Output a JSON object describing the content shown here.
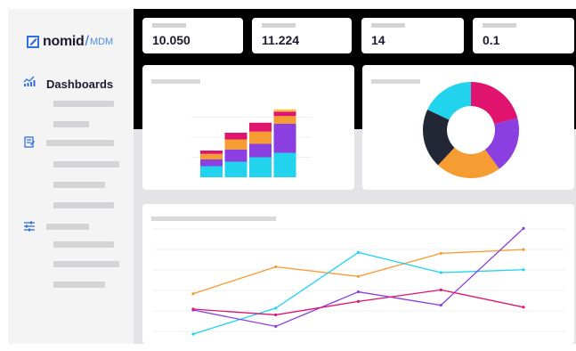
{
  "brand": {
    "name": "nomid",
    "separator": "/",
    "product": "MDM",
    "accent": "#2e6fdc"
  },
  "sidebar": {
    "items": [
      {
        "label": "Dashboards",
        "icon": "dashboard-chart-icon",
        "icon_color": "#2e6fdc"
      },
      {
        "label": "",
        "icon": "clipboard-icon",
        "icon_color": "#2e6fdc"
      },
      {
        "label": "",
        "icon": "sliders-icon",
        "icon_color": "#2e6fdc"
      }
    ]
  },
  "kpis": [
    {
      "value": "10.050"
    },
    {
      "value": "11.224"
    },
    {
      "value": "14"
    },
    {
      "value": "0.1"
    }
  ],
  "colors": {
    "cyan": "#22d3ee",
    "purple": "#8b3fe0",
    "orange": "#f59c32",
    "magenta": "#e0136e",
    "yellow": "#f5c242",
    "navy": "#232735"
  },
  "chart_data": [
    {
      "type": "bar",
      "stacked": true,
      "categories": [
        "",
        "",
        "",
        ""
      ],
      "series": [
        {
          "color": "#22d3ee",
          "values": [
            10,
            14,
            18,
            22
          ]
        },
        {
          "color": "#8b3fe0",
          "values": [
            6,
            11,
            12,
            26
          ]
        },
        {
          "color": "#f59c32",
          "values": [
            5,
            9,
            11,
            7
          ]
        },
        {
          "color": "#e0136e",
          "values": [
            3,
            6,
            8,
            4
          ]
        },
        {
          "color": "#f5c242",
          "values": [
            0,
            0,
            0,
            2
          ]
        }
      ],
      "ylim": [
        0,
        72
      ],
      "title": ""
    },
    {
      "type": "pie",
      "donut": true,
      "slices": [
        {
          "color": "#e0136e",
          "value": 21
        },
        {
          "color": "#8b3fe0",
          "value": 19
        },
        {
          "color": "#f59c32",
          "value": 22
        },
        {
          "color": "#232735",
          "value": 20
        },
        {
          "color": "#22d3ee",
          "value": 18
        }
      ],
      "title": ""
    },
    {
      "type": "line",
      "x": [
        1,
        2,
        3,
        4,
        5
      ],
      "series": [
        {
          "color": "#f59c32",
          "values": [
            42,
            70,
            60,
            84,
            88
          ]
        },
        {
          "color": "#22d3ee",
          "values": [
            0,
            27,
            85,
            64,
            67
          ]
        },
        {
          "color": "#8b3fe0",
          "values": [
            25,
            8,
            44,
            30,
            110
          ]
        },
        {
          "color": "#e0136e",
          "values": [
            26,
            20,
            34,
            46,
            28
          ]
        }
      ],
      "ylim": [
        0,
        115
      ],
      "title": ""
    }
  ]
}
